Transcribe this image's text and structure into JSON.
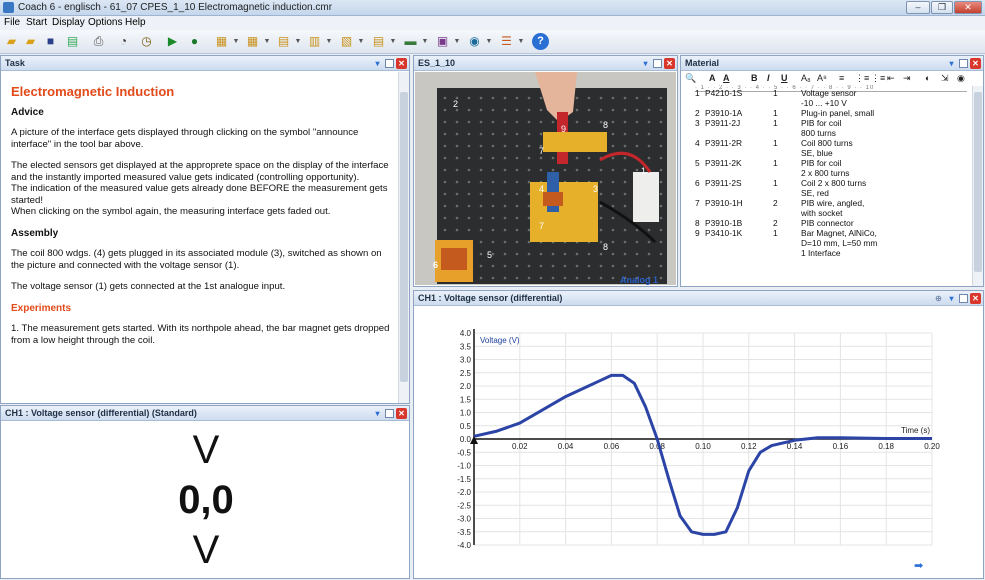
{
  "window": {
    "title": "Coach 6 - englisch - 61_07 CPES_1_10 Electromagnetic induction.cmr",
    "minimize": "–",
    "restore": "❐",
    "close": "✕"
  },
  "menu": [
    "File",
    "Start",
    "Display",
    "Options",
    "Help"
  ],
  "toolbar": {
    "icons": [
      "open-folder-icon",
      "open-file-icon",
      "save-icon",
      "export-icon",
      "print-icon",
      "activity-icon",
      "timer-icon",
      "start-icon",
      "stop-icon",
      "table-icon",
      "diagram-icon",
      "text-icon",
      "graph-icon",
      "meter-icon",
      "value-icon",
      "video-icon",
      "image-icon",
      "analysis-icon",
      "help-icon"
    ],
    "arrow": "▼"
  },
  "task": {
    "header": "Task",
    "title": "Electromagnetic Induction",
    "advice_h": "Advice",
    "p1": "A picture of the interface gets displayed through clicking on the symbol \"announce interface\" in the tool bar above.",
    "p2": " The elected sensors get displayed at the approprete space on the display of the interface and the instantly imported measured value gets indicated (controlling opportunity).",
    "p3": "The indication of the measured value gets already done BEFORE the measurement gets started!",
    "p4": "When clicking on the symbol again, the measuring interface gets faded out.",
    "assembly_h": "Assembly",
    "p5": "The coil 800 wdgs. (4) gets plugged in its associated module (3), switched as shown on the picture and connected with the voltage sensor (1).",
    "p6": "The voltage sensor (1) gets connected at the 1st analogue input.",
    "experiments_h": "Experiments",
    "p7": "1. The measurement gets started. With its northpole ahead, the bar magnet gets dropped from a low height through the coil."
  },
  "meter": {
    "header": "CH1 : Voltage sensor (differential) (Standard)",
    "unit_top": "V",
    "value": "0,0",
    "unit_bottom": "V"
  },
  "photo": {
    "header": "ES_1_10",
    "analog_label": "Analog 1",
    "labels": [
      "2",
      "9",
      "8",
      "7",
      "4",
      "3",
      "1",
      "7",
      "8",
      "6",
      "5"
    ]
  },
  "material": {
    "header": "Material",
    "toolbar": [
      "🔍",
      "A",
      "A",
      "B",
      "I",
      "U",
      "A₈",
      "A⁸",
      "≡",
      "⋮≡",
      "⋮≡",
      "⇤",
      "⇥",
      "◐",
      "⇲",
      "◉"
    ],
    "ruler": "· 1 · · 2 · · 3 · · 4 · · 5 · · 6 · · 7 · · 8 · · 9 · · 10",
    "rows": [
      {
        "n": "1",
        "code": "P4210-1S",
        "qty": "1",
        "desc": [
          "Voltage sensor",
          "-10 ... +10 V"
        ]
      },
      {
        "n": "2",
        "code": "P3910-1A",
        "qty": "1",
        "desc": [
          "Plug-in panel, small"
        ]
      },
      {
        "n": "3",
        "code": "P3911-2J",
        "qty": "1",
        "desc": [
          "PIB for coil",
          "800 turns"
        ]
      },
      {
        "n": "4",
        "code": "P3911-2R",
        "qty": "1",
        "desc": [
          "Coil 800 turns",
          "SE, blue"
        ]
      },
      {
        "n": "5",
        "code": "P3911-2K",
        "qty": "1",
        "desc": [
          "PIB for coil",
          "2 x 800 turns"
        ]
      },
      {
        "n": "6",
        "code": "P3911-2S",
        "qty": "1",
        "desc": [
          "Coil 2 x 800 turns",
          "SE, red"
        ]
      },
      {
        "n": "7",
        "code": "P3910-1H",
        "qty": "2",
        "desc": [
          "PIB wire, angled,",
          "with socket"
        ]
      },
      {
        "n": "8",
        "code": "P3910-1B",
        "qty": "2",
        "desc": [
          "PIB connector"
        ]
      },
      {
        "n": "9",
        "code": "P3410-1K",
        "qty": "1",
        "desc": [
          "Bar Magnet, AlNiCo,",
          "D=10 mm, L=50 mm",
          "1 Interface"
        ]
      }
    ]
  },
  "graph": {
    "header": "CH1 : Voltage sensor (differential)"
  },
  "chart_data": {
    "type": "line",
    "title": "",
    "ylabel": "Voltage (V)",
    "xlabel": "Time (s)",
    "xlim": [
      0,
      0.2
    ],
    "ylim": [
      -4.0,
      4.0
    ],
    "xticks": [
      0.02,
      0.04,
      0.06,
      0.08,
      0.1,
      0.12,
      0.14,
      0.16,
      0.18,
      0.2
    ],
    "yticks": [
      4.0,
      3.5,
      3.0,
      2.5,
      2.0,
      1.5,
      1.0,
      0.5,
      0.0,
      -0.5,
      -1.0,
      -1.5,
      -2.0,
      -2.5,
      -3.0,
      -3.5,
      -4.0
    ],
    "grid": true,
    "series": [
      {
        "color": "#2b44a6",
        "x": [
          0,
          0.01,
          0.02,
          0.03,
          0.04,
          0.05,
          0.055,
          0.06,
          0.065,
          0.07,
          0.075,
          0.08,
          0.085,
          0.09,
          0.095,
          0.1,
          0.105,
          0.11,
          0.115,
          0.12,
          0.125,
          0.13,
          0.14,
          0.15,
          0.16,
          0.18,
          0.2
        ],
        "y": [
          0.1,
          0.3,
          0.6,
          1.1,
          1.6,
          2.0,
          2.2,
          2.4,
          2.4,
          2.1,
          1.2,
          0.0,
          -1.5,
          -2.9,
          -3.5,
          -3.6,
          -3.6,
          -3.5,
          -2.6,
          -1.2,
          -0.5,
          -0.25,
          -0.05,
          0.05,
          0.05,
          0.02,
          0.02
        ]
      }
    ]
  }
}
